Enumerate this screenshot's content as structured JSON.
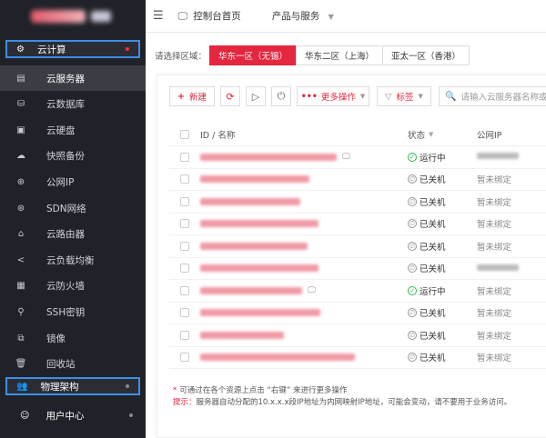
{
  "sidebar": {
    "cloud_compute": "云计算",
    "physical_arch": "物理架构",
    "user_center": "用户中心",
    "items": [
      {
        "label": "云服务器",
        "icon": "server-icon",
        "active": true
      },
      {
        "label": "云数据库",
        "icon": "database-icon"
      },
      {
        "label": "云硬盘",
        "icon": "disk-icon"
      },
      {
        "label": "快照备份",
        "icon": "snapshot-icon"
      },
      {
        "label": "公网IP",
        "icon": "public-ip-icon"
      },
      {
        "label": "SDN网络",
        "icon": "sdn-icon"
      },
      {
        "label": "云路由器",
        "icon": "router-icon"
      },
      {
        "label": "云负载均衡",
        "icon": "share-icon"
      },
      {
        "label": "云防火墙",
        "icon": "firewall-icon"
      },
      {
        "label": "SSH密钥",
        "icon": "key-icon"
      },
      {
        "label": "镜像",
        "icon": "mirror-icon"
      },
      {
        "label": "回收站",
        "icon": "trash-icon"
      }
    ]
  },
  "topbar": {
    "console": "控制台首页",
    "products": "产品与服务"
  },
  "region": {
    "label": "请选择区域：",
    "options": [
      "华东一区（无锡）",
      "华东二区（上海）",
      "亚太一区（香港）"
    ]
  },
  "toolbar": {
    "new": "新建",
    "more": "更多操作",
    "tag": "标签",
    "search_placeholder": "请输入云服务器名称或IP"
  },
  "table": {
    "headers": [
      "ID / 名称",
      "状态",
      "公网IP"
    ],
    "rows": [
      {
        "status": "运行中",
        "running": true,
        "ip": "",
        "has_mon": true,
        "w": 150
      },
      {
        "status": "已关机",
        "running": false,
        "ip": "暂未绑定",
        "w": 120
      },
      {
        "status": "已关机",
        "running": false,
        "ip": "暂未绑定",
        "w": 110
      },
      {
        "status": "已关机",
        "running": false,
        "ip": "暂未绑定",
        "w": 130
      },
      {
        "status": "已关机",
        "running": false,
        "ip": "暂未绑定",
        "w": 118
      },
      {
        "status": "已关机",
        "running": false,
        "ip": "",
        "w": 130
      },
      {
        "status": "运行中",
        "running": true,
        "ip": "暂未绑定",
        "has_mon": true,
        "w": 112
      },
      {
        "status": "已关机",
        "running": false,
        "ip": "暂未绑定",
        "w": 132
      },
      {
        "status": "已关机",
        "running": false,
        "ip": "暂未绑定",
        "w": 92
      },
      {
        "status": "已关机",
        "running": false,
        "ip": "暂未绑定",
        "w": 170
      }
    ]
  },
  "notes": {
    "line1": "可通过在各个资源上点击 “右键” 来进行更多操作",
    "tip_label": "提示：",
    "line2": "服务器自动分配的10.x.x.x段IP地址为内网映射IP地址，可能会变动，请不要用于业务访问。"
  },
  "colors": {
    "accent": "#e4263e",
    "sidebar": "#1f2228",
    "highlight": "#3e8ee8"
  }
}
